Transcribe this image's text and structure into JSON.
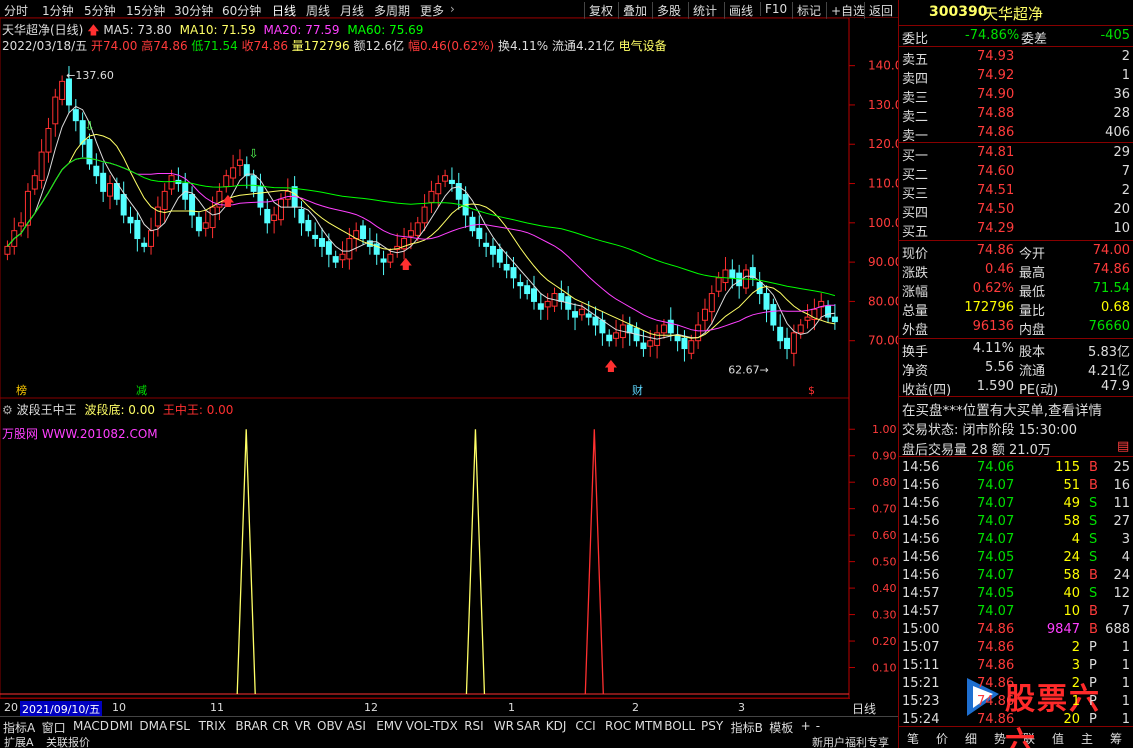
{
  "toolbar": {
    "periods": [
      "分时",
      "1分钟",
      "5分钟",
      "15分钟",
      "30分钟",
      "60分钟",
      "日线",
      "周线",
      "月线",
      "多周期",
      "更多"
    ],
    "buttons": [
      "复权",
      "叠加",
      "多股",
      "统计",
      "画线",
      "F10",
      "标记",
      "+自选",
      "返回"
    ]
  },
  "main_header": {
    "title": "天华超净(日线)",
    "ma5": "MA5: 73.80",
    "ma10": "MA10: 71.59",
    "ma20": "MA20: 77.59",
    "ma60": "MA60: 75.69",
    "date": "2022/03/18/五",
    "open": "开74.00",
    "high": "高74.86",
    "low": "低71.54",
    "close": "收74.86",
    "vol": "量172796",
    "amount": "额12.6亿",
    "change": "幅0.46(0.62%)",
    "turnover": "换4.11%",
    "float": "流通4.21亿",
    "sector": "电气设备"
  },
  "main_axis": [
    "140.0",
    "130.0",
    "120.0",
    "110.0",
    "100.0",
    "90.00",
    "80.00",
    "70.00"
  ],
  "annotations": {
    "high_label": "137.60",
    "low_label": "62.67",
    "tag1": "榜",
    "tag2": "减",
    "tag3": "财",
    "tag4": "$"
  },
  "sub_header": {
    "name": "波段王中王",
    "v1": "波段底: 0.00",
    "v2": "王中王: 0.00",
    "site": "万股网 WWW.201082.COM"
  },
  "sub_axis": [
    "1.00",
    "0.90",
    "0.80",
    "0.70",
    "0.60",
    "0.50",
    "0.40",
    "0.30",
    "0.20",
    "0.10"
  ],
  "datebar": {
    "left": "20",
    "selected": "2021/09/10/五",
    "months": [
      "10",
      "11",
      "12",
      "1",
      "2",
      "3"
    ],
    "period": "日线"
  },
  "bottom_tabs": [
    "指标A",
    "窗口",
    "MACD",
    "DMI",
    "DMA",
    "FSL",
    "TRIX",
    "BRAR",
    "CR",
    "VR",
    "OBV",
    "ASI",
    "EMV",
    "VOL-TDX",
    "RSI",
    "WR",
    "SAR",
    "KDJ",
    "CCI",
    "ROC",
    "MTM",
    "BOLL",
    "PSY",
    "指标B",
    "模板",
    "+",
    "-"
  ],
  "status": {
    "left": "扩展A",
    "mid": "关联报价",
    "right": "新用户福利专享"
  },
  "quote": {
    "code": "300390",
    "name": "天华超净",
    "weibi_label": "委比",
    "weibi": "-74.86%",
    "weicha_label": "委差",
    "weicha": "-405",
    "sell": [
      {
        "label": "卖五",
        "price": "74.93",
        "vol": "2"
      },
      {
        "label": "卖四",
        "price": "74.92",
        "vol": "1"
      },
      {
        "label": "卖三",
        "price": "74.90",
        "vol": "36"
      },
      {
        "label": "卖二",
        "price": "74.88",
        "vol": "28"
      },
      {
        "label": "卖一",
        "price": "74.86",
        "vol": "406"
      }
    ],
    "buy": [
      {
        "label": "买一",
        "price": "74.81",
        "vol": "29"
      },
      {
        "label": "买二",
        "price": "74.60",
        "vol": "7"
      },
      {
        "label": "买三",
        "price": "74.51",
        "vol": "2"
      },
      {
        "label": "买四",
        "price": "74.50",
        "vol": "20"
      },
      {
        "label": "买五",
        "price": "74.29",
        "vol": "10"
      }
    ],
    "stats": [
      {
        "l1": "现价",
        "v1": "74.86",
        "c1": "red",
        "l2": "今开",
        "v2": "74.00",
        "c2": "red"
      },
      {
        "l1": "涨跌",
        "v1": "0.46",
        "c1": "red",
        "l2": "最高",
        "v2": "74.86",
        "c2": "red"
      },
      {
        "l1": "涨幅",
        "v1": "0.62%",
        "c1": "red",
        "l2": "最低",
        "v2": "71.54",
        "c2": "green"
      },
      {
        "l1": "总量",
        "v1": "172796",
        "c1": "yellow",
        "l2": "量比",
        "v2": "0.68",
        "c2": "yellow"
      },
      {
        "l1": "外盘",
        "v1": "96136",
        "c1": "red",
        "l2": "内盘",
        "v2": "76660",
        "c2": "green"
      }
    ],
    "stats2": [
      {
        "l1": "换手",
        "v1": "4.11%",
        "l2": "股本",
        "v2": "5.83亿"
      },
      {
        "l1": "净资",
        "v1": "5.56",
        "l2": "流通",
        "v2": "4.21亿"
      },
      {
        "l1": "收益(四)",
        "v1": "1.590",
        "l2": "PE(动)",
        "v2": "47.9"
      }
    ],
    "notice": "在买盘***位置有大买单,查看详情",
    "trade_status": "交易状态: 闭市阶段 15:30:00",
    "after_hours": "盘后交易量 28 额 21.0万",
    "ticks": [
      {
        "t": "14:56",
        "p": "74.06",
        "v": "115",
        "bs": "B",
        "n": "25",
        "pc": "green"
      },
      {
        "t": "14:56",
        "p": "74.07",
        "v": "51",
        "bs": "B",
        "n": "16",
        "pc": "green"
      },
      {
        "t": "14:56",
        "p": "74.07",
        "v": "49",
        "bs": "S",
        "n": "11",
        "pc": "green"
      },
      {
        "t": "14:56",
        "p": "74.07",
        "v": "58",
        "bs": "S",
        "n": "27",
        "pc": "green"
      },
      {
        "t": "14:56",
        "p": "74.07",
        "v": "4",
        "bs": "S",
        "n": "3",
        "pc": "green"
      },
      {
        "t": "14:56",
        "p": "74.05",
        "v": "24",
        "bs": "S",
        "n": "4",
        "pc": "green"
      },
      {
        "t": "14:56",
        "p": "74.07",
        "v": "58",
        "bs": "B",
        "n": "24",
        "pc": "green"
      },
      {
        "t": "14:57",
        "p": "74.05",
        "v": "40",
        "bs": "S",
        "n": "12",
        "pc": "green"
      },
      {
        "t": "14:57",
        "p": "74.07",
        "v": "10",
        "bs": "B",
        "n": "7",
        "pc": "green"
      },
      {
        "t": "15:00",
        "p": "74.86",
        "v": "9847",
        "bs": "B",
        "n": "688",
        "pc": "red"
      },
      {
        "t": "15:07",
        "p": "74.86",
        "v": "2",
        "bs": "P",
        "n": "1",
        "pc": "red"
      },
      {
        "t": "15:11",
        "p": "74.86",
        "v": "3",
        "bs": "P",
        "n": "1",
        "pc": "red"
      },
      {
        "t": "15:21",
        "p": "74.86",
        "v": "2",
        "bs": "P",
        "n": "1",
        "pc": "red"
      },
      {
        "t": "15:23",
        "p": "74.86",
        "v": "1",
        "bs": "P",
        "n": "1",
        "pc": "red"
      },
      {
        "t": "15:24",
        "p": "74.86",
        "v": "20",
        "bs": "P",
        "n": "1",
        "pc": "red"
      }
    ],
    "bottom_tabs": [
      "笔",
      "价",
      "细",
      "势",
      "联",
      "值",
      "主",
      "筹"
    ],
    "watermark": "股票六六"
  },
  "chart_data": [
    {
      "type": "candlestick",
      "title": "天华超净(日线)",
      "ylim": [
        60,
        145
      ],
      "x": "trading days, 2021-09 to 2022-03-18",
      "closes": [
        94,
        98,
        100,
        108,
        112,
        118,
        124,
        132,
        136,
        130,
        126,
        120,
        115,
        112,
        108,
        110,
        106,
        102,
        100,
        96,
        94,
        98,
        104,
        108,
        112,
        110,
        106,
        102,
        98,
        100,
        104,
        108,
        112,
        114,
        116,
        112,
        108,
        104,
        100,
        102,
        106,
        108,
        104,
        100,
        98,
        96,
        94,
        92,
        90,
        92,
        96,
        98,
        96,
        94,
        92,
        90,
        92,
        94,
        96,
        98,
        100,
        104,
        108,
        110,
        112,
        110,
        106,
        102,
        98,
        96,
        94,
        92,
        90,
        88,
        86,
        84,
        82,
        80,
        78,
        80,
        82,
        80,
        78,
        76,
        78,
        76,
        74,
        72,
        70,
        72,
        74,
        72,
        70,
        68,
        70,
        72,
        74,
        72,
        70,
        68,
        70,
        74,
        78,
        82,
        86,
        88,
        86,
        84,
        88,
        86,
        82,
        78,
        74,
        70,
        68,
        72,
        74,
        76,
        78,
        80,
        76,
        74.86
      ],
      "ma5": 73.8,
      "ma10": 71.59,
      "ma20": 77.59,
      "ma60": 75.69,
      "high_mark": 137.6,
      "low_mark": 62.67,
      "last": {
        "open": 74.0,
        "high": 74.86,
        "low": 71.54,
        "close": 74.86
      }
    },
    {
      "type": "line",
      "title": "波段王中王",
      "ylim": [
        0,
        1.05
      ],
      "series": [
        {
          "name": "波段底",
          "color": "#ffff66",
          "spikes": [
            0.29,
            0.56
          ]
        },
        {
          "name": "王中王",
          "color": "#ff3030",
          "spikes": [
            0.7
          ]
        }
      ]
    }
  ]
}
